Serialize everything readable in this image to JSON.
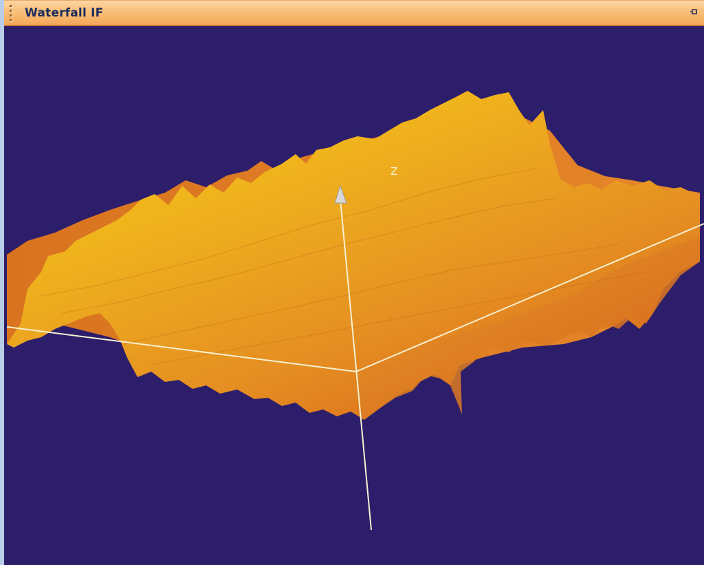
{
  "window": {
    "title": "Waterfall IF"
  },
  "icons": {
    "pin": "pin-icon",
    "grip": "grip-icon"
  },
  "plot": {
    "z_axis_label": "Z"
  },
  "colors": {
    "background": "#2d1e6b",
    "titlebar": "#f9bf78",
    "title_text": "#1c2c5e",
    "surface_light": "#f1c20f",
    "surface_dark": "#d9631c",
    "axis": "#f5f0d0"
  }
}
